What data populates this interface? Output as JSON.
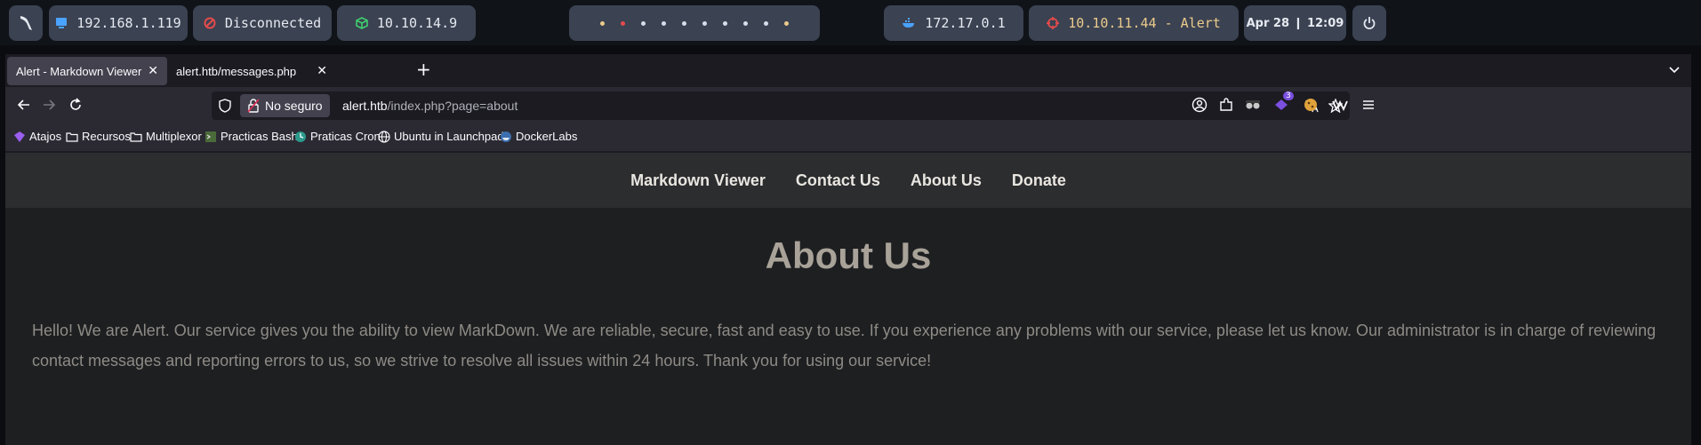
{
  "system_bar": {
    "local_ip": "192.168.1.119",
    "vpn_status": "Disconnected",
    "vpn_ip": "10.10.14.9",
    "docker_ip": "172.17.0.1",
    "target": "10.10.11.44 - Alert",
    "clock": "Apr 28 ❙ 12:09",
    "colors": {
      "pill_bg": "#3b4252",
      "alert_text": "#ebcb8b",
      "red_icon": "#e34b4b",
      "green_icon": "#3fcf6e",
      "blue_icon": "#4aa3ff"
    }
  },
  "browser": {
    "tabs": [
      {
        "label": "Alert - Markdown Viewer",
        "active": true
      },
      {
        "label": "alert.htb/messages.php",
        "active": false
      }
    ],
    "security_label": "No seguro",
    "url_host": "alert.htb",
    "url_path": "/index.php?page=about",
    "extension_badge": "3",
    "bookmarks": [
      {
        "label": "Atajos",
        "icon": "purple-gem-icon"
      },
      {
        "label": "Recursos",
        "icon": "folder-icon"
      },
      {
        "label": "Multiplexor",
        "icon": "folder-icon"
      },
      {
        "label": "Practicas Bash",
        "icon": "bash-favicon-icon"
      },
      {
        "label": "Praticas Cron",
        "icon": "cron-favicon-icon"
      },
      {
        "label": "Ubuntu in Launchpad",
        "icon": "globe-icon"
      },
      {
        "label": "DockerLabs",
        "icon": "dockerlabs-favicon-icon"
      }
    ]
  },
  "site": {
    "nav": [
      "Markdown Viewer",
      "Contact Us",
      "About Us",
      "Donate"
    ],
    "heading": "About Us",
    "body": "Hello! We are Alert. Our service gives you the ability to view MarkDown. We are reliable, secure, fast and easy to use. If you experience any problems with our service, please let us know. Our administrator is in charge of reviewing contact messages and reporting errors to us, so we strive to resolve all issues within 24 hours. Thank you for using our service!"
  }
}
